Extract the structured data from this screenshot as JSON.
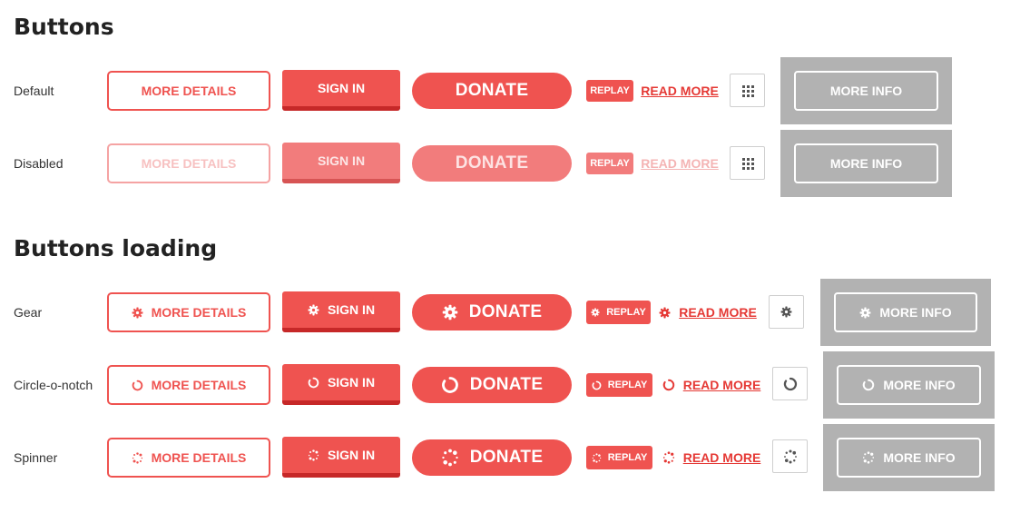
{
  "sections": {
    "buttons": "Buttons",
    "buttons_loading": "Buttons loading"
  },
  "rows": {
    "default": "Default",
    "disabled": "Disabled",
    "gear": "Gear",
    "circle_o_notch": "Circle-o-notch",
    "spinner": "Spinner"
  },
  "labels": {
    "more_details": "MORE DETAILS",
    "sign_in": "SIGN IN",
    "donate": "DONATE",
    "replay": "REPLAY",
    "read_more": "READ MORE",
    "more_info": "MORE INFO"
  },
  "icons": {
    "grid": "grid-icon",
    "gear": "gear-icon",
    "circle_o_notch": "circle-o-notch-icon",
    "spinner": "spinner-icon"
  },
  "colors": {
    "accent": "#ef5350",
    "accent_dark": "#c62828",
    "link": "#e53935",
    "grey_panel": "#b2b2b2"
  }
}
